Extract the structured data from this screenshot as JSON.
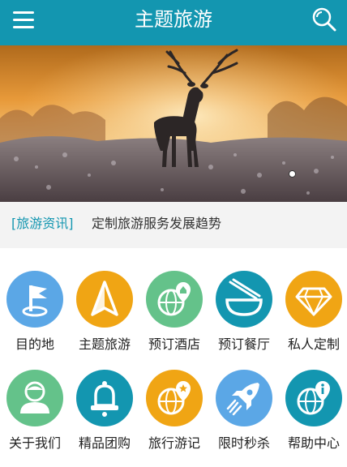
{
  "header": {
    "title": "主题旅游",
    "background": "#1396b0",
    "icons": [
      "menu-icon",
      "search-icon"
    ]
  },
  "banner": {
    "subject": "stag standing in frosty field at sunset",
    "slide_count": 3,
    "active_slide": 1
  },
  "news": {
    "tag": "[旅游资讯]",
    "text": "定制旅游服务发展趋势",
    "tag_color": "#1396b0"
  },
  "grid": {
    "items": [
      {
        "label": "目的地",
        "icon": "flag-pin-icon",
        "color": "#5ba7e6"
      },
      {
        "label": "主题旅游",
        "icon": "navigation-arrow-icon",
        "color": "#f0a514"
      },
      {
        "label": "预订酒店",
        "icon": "globe-pin-hotel-icon",
        "color": "#64c28a"
      },
      {
        "label": "预订餐厅",
        "icon": "bowl-chopsticks-icon",
        "color": "#1396b0"
      },
      {
        "label": "私人定制",
        "icon": "diamond-icon",
        "color": "#f0a514"
      },
      {
        "label": "关于我们",
        "icon": "person-icon",
        "color": "#64c28a"
      },
      {
        "label": "精品团购",
        "icon": "bell-icon",
        "color": "#1396b0"
      },
      {
        "label": "旅行游记",
        "icon": "globe-pin-star-icon",
        "color": "#f0a514"
      },
      {
        "label": "限时秒杀",
        "icon": "rocket-icon",
        "color": "#5ba7e6"
      },
      {
        "label": "帮助中心",
        "icon": "globe-info-icon",
        "color": "#1396b0"
      }
    ]
  }
}
